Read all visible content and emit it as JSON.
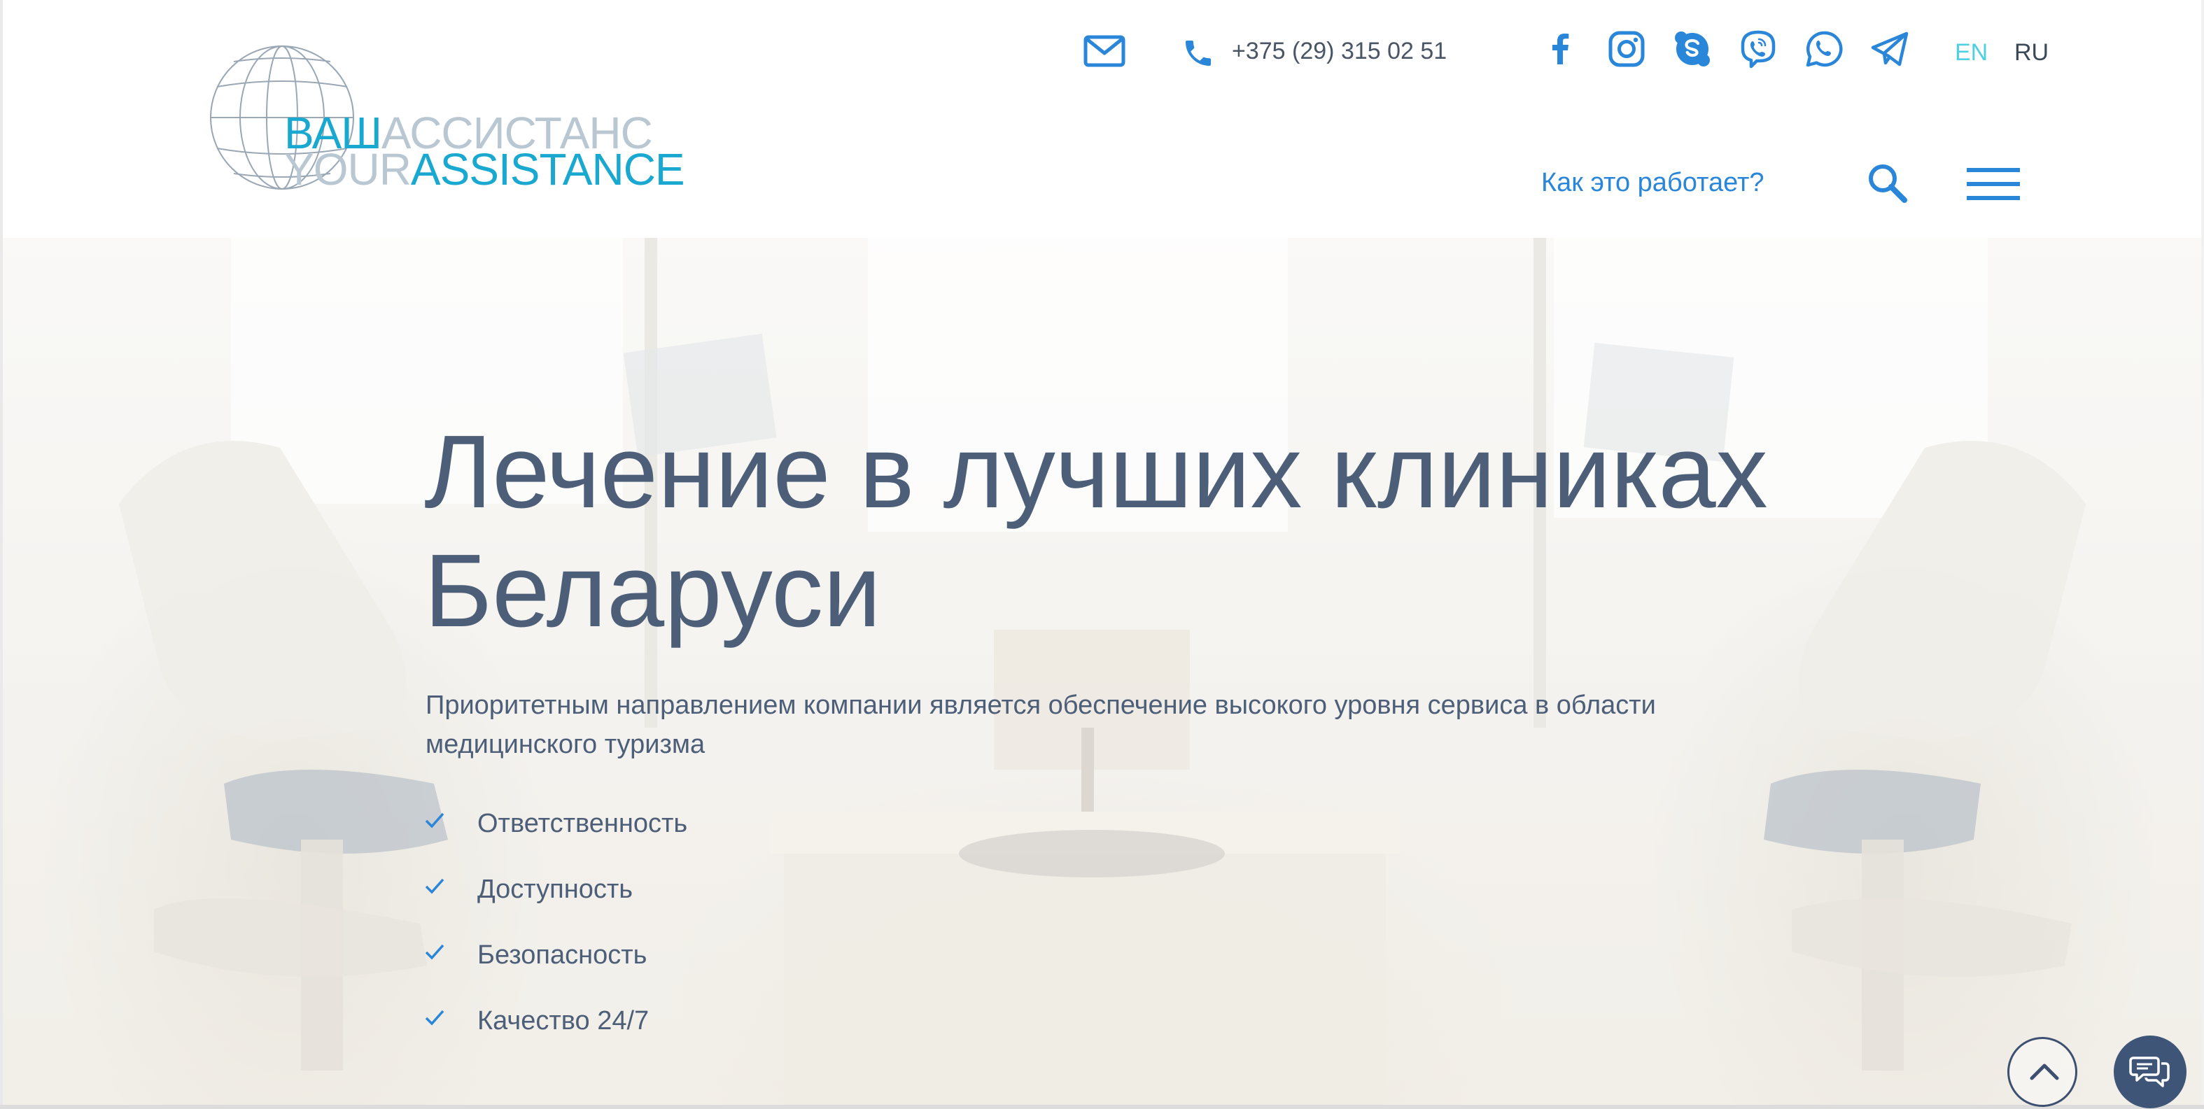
{
  "header": {
    "logo": {
      "line1_accent": "ВАШ",
      "line1_light": "АССИСТАНС",
      "line2_light": "YOUR",
      "line2_accent": "ASSISTANCE"
    },
    "contacts": {
      "mail_icon": "mail-icon",
      "phone_icon": "phone-icon",
      "phone": "+375 (29) 315 02 51"
    },
    "social": [
      {
        "name": "facebook-icon"
      },
      {
        "name": "instagram-icon"
      },
      {
        "name": "skype-icon"
      },
      {
        "name": "viber-icon"
      },
      {
        "name": "whatsapp-icon"
      },
      {
        "name": "telegram-icon"
      }
    ],
    "languages": {
      "en": "EN",
      "ru": "RU",
      "active": "EN"
    },
    "nav": {
      "how_it_works": "Как это работает?",
      "search_icon": "search-icon",
      "menu_icon": "hamburger-menu-icon"
    }
  },
  "hero": {
    "title_line1": "Лечение в лучших клиниках",
    "title_line2": "Беларуси",
    "subtitle_line1": "Приоритетным направлением компании является обеспечение высокого уровня сервиса в области",
    "subtitle_line2": "медицинского туризма",
    "features": [
      "Ответственность",
      "Доступность",
      "Безопасность",
      "Качество 24/7"
    ]
  },
  "controls": {
    "scroll_top_icon": "chevron-up-icon",
    "chat_icon": "chat-icon"
  },
  "colors": {
    "accent_blue": "#2a86d8",
    "logo_cyan": "#19a8cf",
    "text_slate": "#4d5f78",
    "lang_active": "#4fd0e0",
    "chat_bg": "#3f5577"
  }
}
